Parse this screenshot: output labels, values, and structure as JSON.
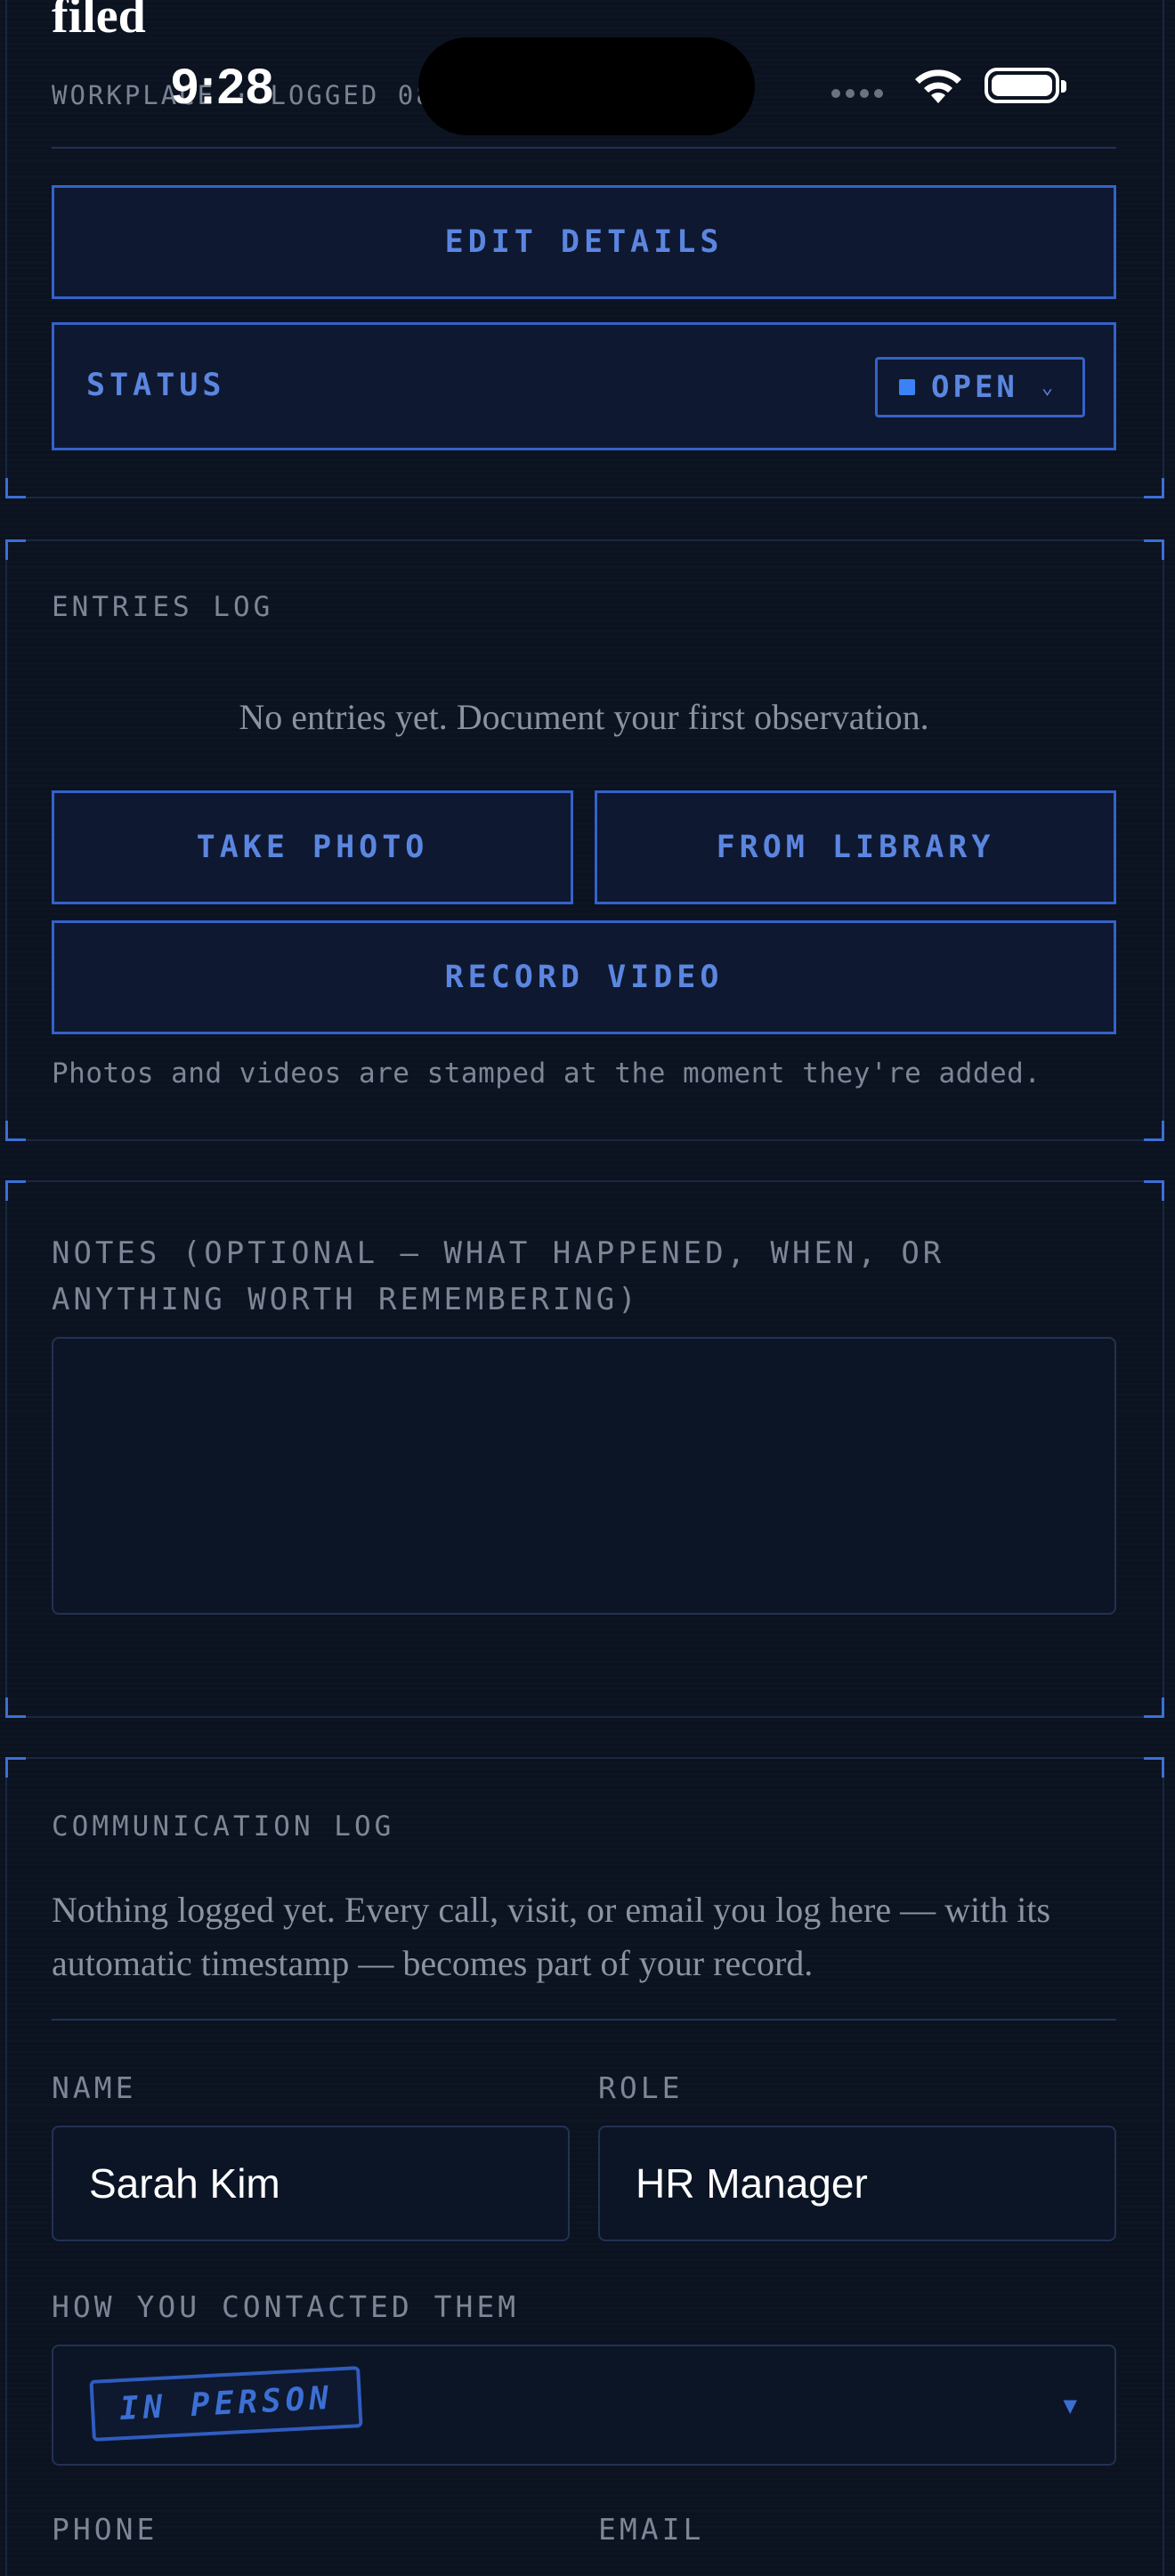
{
  "status_bar": {
    "time": "9:28"
  },
  "header": {
    "title": "filed",
    "meta": "WORKPLACE · LOGGED 08/…  ·  OPEN 0D"
  },
  "case_actions": {
    "edit_label": "EDIT DETAILS",
    "status_label": "STATUS",
    "status_value": "OPEN",
    "status_color": "#3b82f6"
  },
  "entries": {
    "heading": "ENTRIES LOG",
    "empty_text": "No entries yet. Document your first observation.",
    "take_photo": "TAKE PHOTO",
    "from_library": "FROM LIBRARY",
    "record_video": "RECORD VIDEO",
    "footnote": "Photos and videos are stamped at the moment they're added."
  },
  "notes": {
    "label": "NOTES (OPTIONAL — WHAT HAPPENED, WHEN, OR ANYTHING WORTH REMEMBERING)",
    "value": ""
  },
  "communication": {
    "heading": "COMMUNICATION LOG",
    "empty_text": "Nothing logged yet. Every call, visit, or email you log here — with its automatic timestamp — becomes part of your record.",
    "name_label": "NAME",
    "name_value": "Sarah Kim",
    "role_label": "ROLE",
    "role_value": "HR Manager",
    "method_label": "HOW YOU CONTACTED THEM",
    "method_value": "IN PERSON",
    "phone_label": "PHONE",
    "email_label": "EMAIL"
  },
  "colors": {
    "background": "#0b1220",
    "accent": "#3462c9",
    "accent_text": "#5b86e0",
    "muted_text": "#7d8596"
  }
}
